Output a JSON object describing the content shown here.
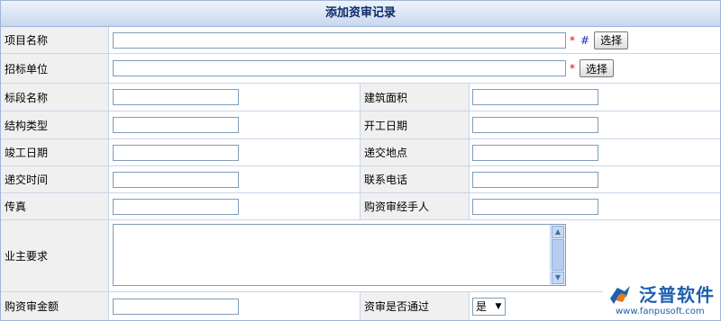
{
  "title": "添加资审记录",
  "project_name": {
    "label": "项目名称",
    "value": "",
    "required": "*",
    "hash": "#",
    "button": "选择"
  },
  "tender_unit": {
    "label": "招标单位",
    "value": "",
    "required": "*",
    "button": "选择"
  },
  "section_name": {
    "label": "标段名称",
    "value": ""
  },
  "building_area": {
    "label": "建筑面积",
    "value": ""
  },
  "structure_type": {
    "label": "结构类型",
    "value": ""
  },
  "start_date": {
    "label": "开工日期",
    "value": ""
  },
  "completion_date": {
    "label": "竣工日期",
    "value": ""
  },
  "submit_location": {
    "label": "递交地点",
    "value": ""
  },
  "submit_time": {
    "label": "递交时间",
    "value": ""
  },
  "contact_phone": {
    "label": "联系电话",
    "value": ""
  },
  "fax": {
    "label": "传真",
    "value": ""
  },
  "handler": {
    "label": "购资审经手人",
    "value": ""
  },
  "owner_requirement": {
    "label": "业主要求",
    "value": ""
  },
  "purchase_amount": {
    "label": "购资审金额",
    "value": ""
  },
  "review_passed": {
    "label": "资审是否通过",
    "selected": "是"
  },
  "watermark": {
    "brand": "泛普软件",
    "url": "www.fanpusoft.com"
  }
}
